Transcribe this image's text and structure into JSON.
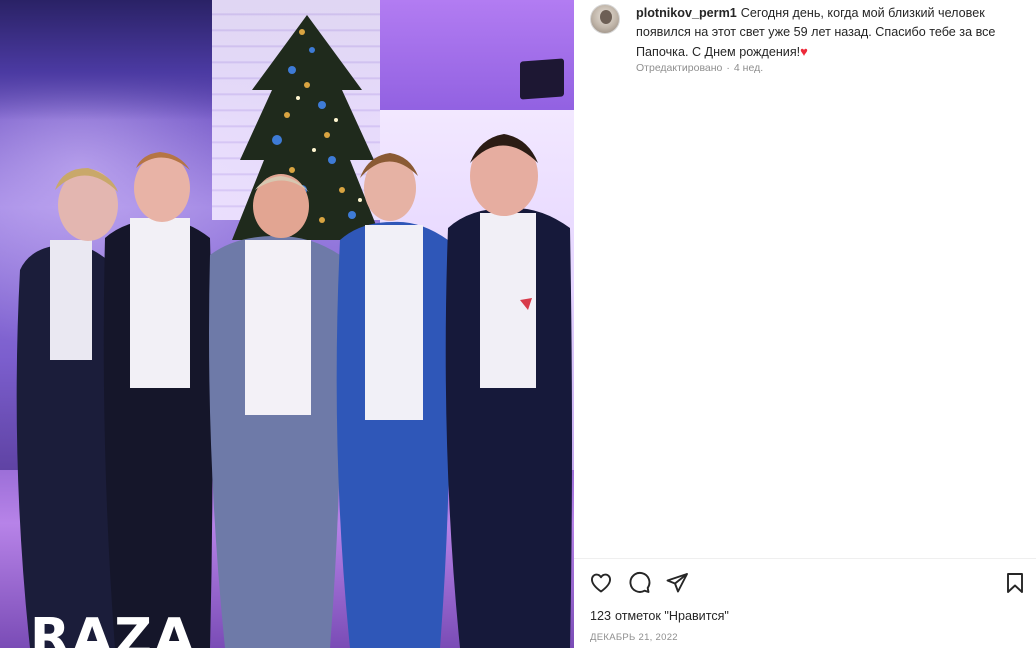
{
  "post": {
    "username": "plotnikov_perm1",
    "caption": "Сегодня день, когда мой близкий человек появился на этот свет уже 59 лет назад. Спасибо тебе за все Папочка. С Днем рождения!",
    "caption_emoji": "♥",
    "edited_label": "Отредактировано",
    "edited_sep": "·",
    "edited_time": "4 нед.",
    "likes_count": "123",
    "likes_label": "отметок \"Нравится\"",
    "date": "ДЕКАБРЬ 21, 2022"
  },
  "photo": {
    "watermark": "RAZA"
  },
  "icons": {
    "like": "heart-outline-icon",
    "comment": "comment-bubble-icon",
    "share": "paper-plane-icon",
    "save": "bookmark-icon"
  },
  "colors": {
    "heart_emoji": "#ed2939",
    "text_primary": "#262626",
    "text_secondary": "#8e8e8e"
  }
}
